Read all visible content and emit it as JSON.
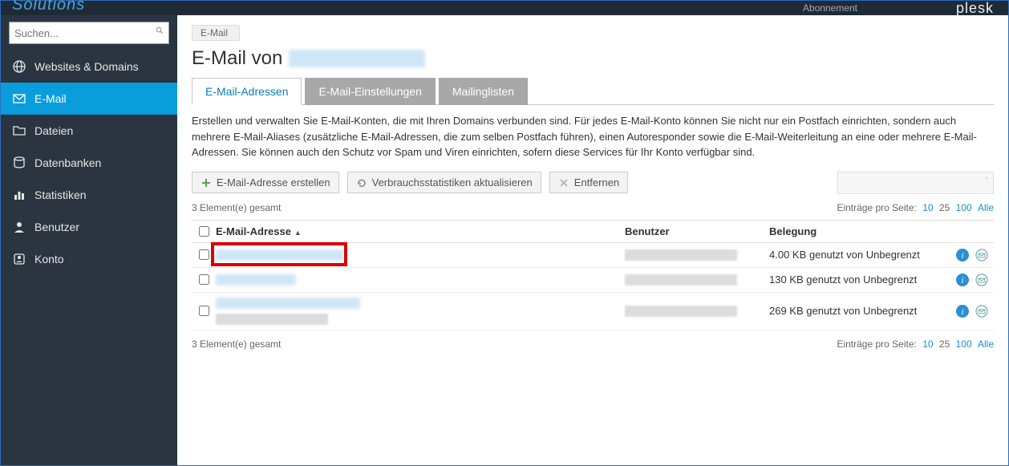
{
  "topbar": {
    "subscription": "Abonnement",
    "brand": "plesk",
    "logo_left": "Solutions"
  },
  "search": {
    "placeholder": "Suchen..."
  },
  "sidebar": {
    "items": [
      {
        "label": "Websites & Domains",
        "icon": "globe"
      },
      {
        "label": "E-Mail",
        "icon": "mail",
        "active": true
      },
      {
        "label": "Dateien",
        "icon": "folder"
      },
      {
        "label": "Datenbanken",
        "icon": "database"
      },
      {
        "label": "Statistiken",
        "icon": "stats"
      },
      {
        "label": "Benutzer",
        "icon": "user"
      },
      {
        "label": "Konto",
        "icon": "account"
      }
    ]
  },
  "breadcrumb": "E-Mail",
  "page_title_prefix": "E-Mail von ",
  "tabs": [
    {
      "label": "E-Mail-Adressen",
      "active": true
    },
    {
      "label": "E-Mail-Einstellungen"
    },
    {
      "label": "Mailinglisten"
    }
  ],
  "description": "Erstellen und verwalten Sie E-Mail-Konten, die mit Ihren Domains verbunden sind. Für jedes E-Mail-Konto können Sie nicht nur ein Postfach einrichten, sondern auch mehrere E-Mail-Aliases (zusätzliche E-Mail-Adressen, die zum selben Postfach führen), einen Autoresponder sowie die E-Mail-Weiterleitung an eine oder mehrere E-Mail-Adressen. Sie können auch den Schutz vor Spam und Viren einrichten, sofern diese Services für Ihr Konto verfügbar sind.",
  "toolbar": {
    "create": "E-Mail-Adresse erstellen",
    "refresh": "Verbrauchsstatistiken aktualisieren",
    "remove": "Entfernen"
  },
  "list": {
    "count_label": "3 Element(e) gesamt",
    "pager_label": "Einträge pro Seite:",
    "pager_options": [
      "10",
      "25",
      "100",
      "Alle"
    ],
    "columns": {
      "email": "E-Mail-Adresse",
      "user": "Benutzer",
      "usage": "Belegung"
    },
    "rows": [
      {
        "usage": "4.00 KB genutzt von Unbegrenzt"
      },
      {
        "usage": "130 KB genutzt von Unbegrenzt"
      },
      {
        "usage": "269 KB genutzt von Unbegrenzt"
      }
    ]
  }
}
